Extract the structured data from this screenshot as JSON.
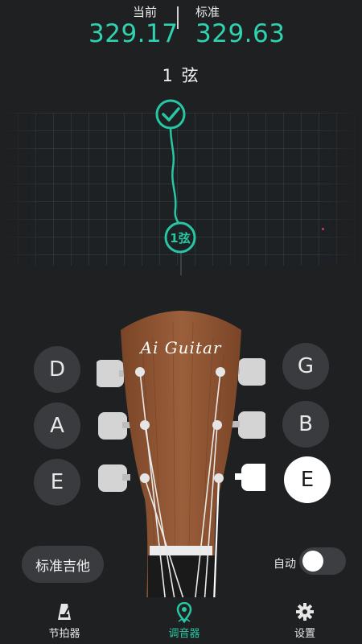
{
  "readout": {
    "current_label": "当前",
    "current_value": "329.17",
    "standard_label": "标准",
    "standard_value": "329.63"
  },
  "string_title": "1 弦",
  "indicator": {
    "status": "in-tune",
    "marker_label": "1弦"
  },
  "headstock": {
    "brand": "Ai Guitar",
    "left_pegs": [
      {
        "note": "D",
        "active": false
      },
      {
        "note": "A",
        "active": false
      },
      {
        "note": "E",
        "active": false
      }
    ],
    "right_pegs": [
      {
        "note": "G",
        "active": false
      },
      {
        "note": "B",
        "active": false
      },
      {
        "note": "E",
        "active": true
      }
    ]
  },
  "controls": {
    "preset_label": "标准吉他",
    "auto_label": "自动",
    "auto_enabled": false
  },
  "tabs": [
    {
      "label": "节拍器",
      "icon": "metronome-icon",
      "active": false
    },
    {
      "label": "调音器",
      "icon": "tuner-pin-icon",
      "active": true
    },
    {
      "label": "设置",
      "icon": "gear-icon",
      "active": false
    }
  ],
  "colors": {
    "accent": "#27c7a3",
    "background": "#1f2022",
    "button": "#3a3b3e",
    "wood": "#8a5232"
  }
}
